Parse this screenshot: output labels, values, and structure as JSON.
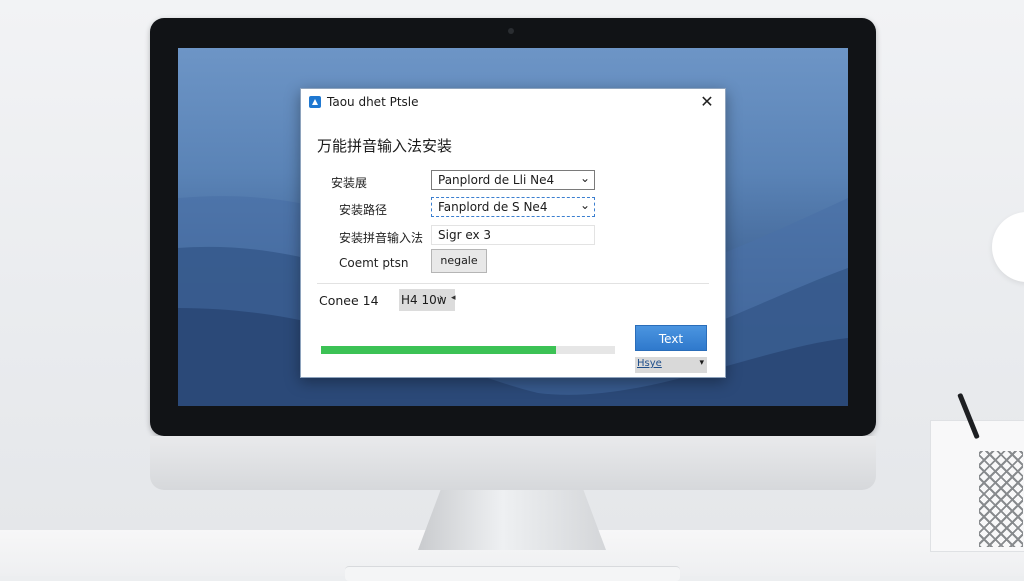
{
  "dialog": {
    "title": "Taou dhet Ptsle",
    "close_glyph": "✕",
    "heading": "万能拼音输入法安装",
    "fields": [
      {
        "label": "安装展",
        "value": "Panplord de Lli Ne4"
      },
      {
        "label": "安装路径",
        "value": "Fanplord de S Ne4"
      },
      {
        "label": "安装拼音输入法",
        "value": "Sigr ex 3"
      },
      {
        "label": "Coemt ptsn",
        "button": "negale"
      }
    ],
    "status": {
      "label": "Conee 14",
      "spin_value": "H4 10w",
      "spin_arrow": "›"
    },
    "primary_button": "Text",
    "progress": 0.8,
    "mini_select": "Hsye",
    "chevron": "⌄"
  },
  "colors": {
    "accent": "#2f79cc",
    "progress": "#3cc255",
    "desktop": "#5a83b6"
  },
  "icons": {
    "app": "installer-icon",
    "close": "close-icon"
  }
}
